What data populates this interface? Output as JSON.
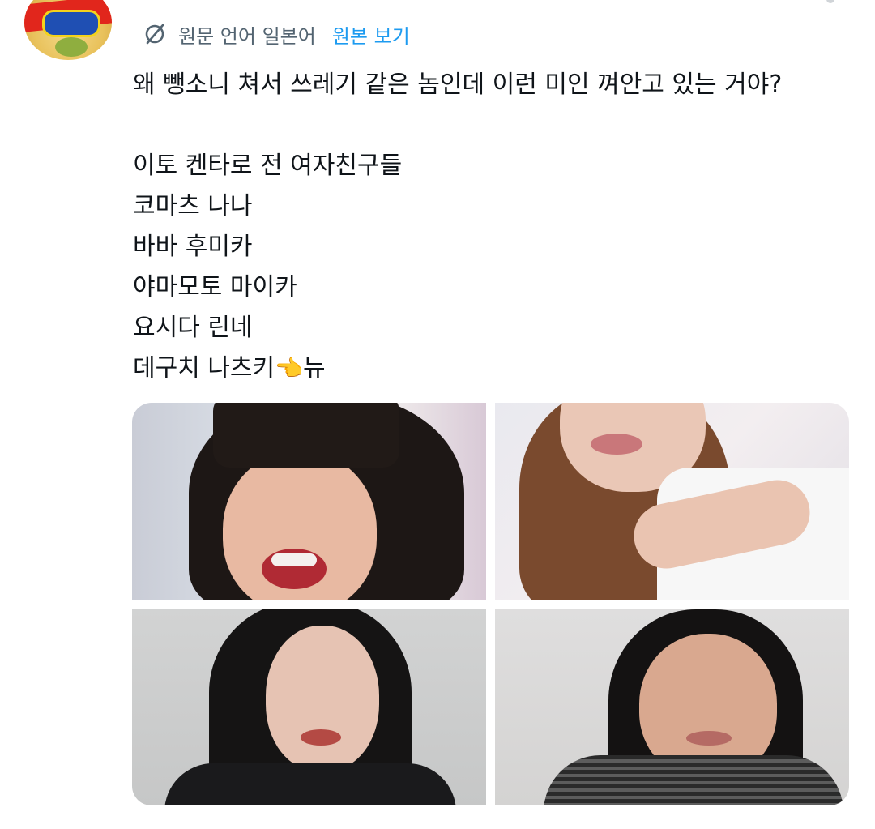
{
  "translation": {
    "icon": "translate-icon",
    "language_note": "원문 언어 일본어",
    "show_original": "원본 보기"
  },
  "tweet": {
    "lines": [
      "왜 뺑소니 쳐서 쓰레기 같은 놈인데 이런 미인 껴안고 있는 거야?",
      "",
      "이토 켄타로 전 여자친구들",
      "코마츠 나나",
      "바바 후미카",
      "야마모토 마이카",
      "요시다 린네",
      "데구치 나츠키👈뉴"
    ],
    "last_line_prefix": "데구치 나츠키",
    "last_line_emoji": "👈",
    "last_line_suffix": "뉴"
  },
  "media": {
    "count": 4,
    "photos": [
      "photo-1",
      "photo-2",
      "photo-3",
      "photo-4"
    ]
  },
  "colors": {
    "link": "#1d9bf0",
    "muted": "#536471",
    "text": "#0f1419"
  }
}
